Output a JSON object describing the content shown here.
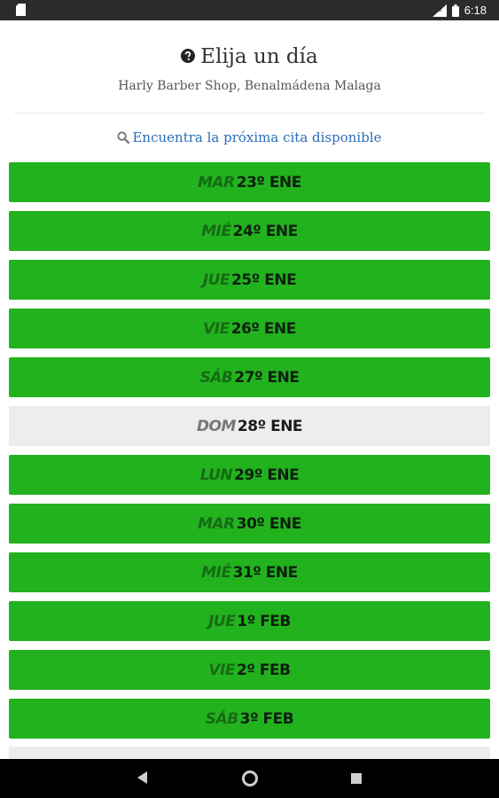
{
  "status_bar": {
    "time": "6:18",
    "icons": [
      "sd-card-icon",
      "signal-icon",
      "battery-icon"
    ]
  },
  "header": {
    "title": "Elija un día",
    "title_icon": "help-circle-icon",
    "subtitle": "Harly Barber Shop, Benalmádena Malaga"
  },
  "find_next": {
    "label": "Encuentra la próxima cita disponible",
    "icon": "search-icon"
  },
  "days": [
    {
      "dow": "MAR",
      "date": "23º ENE",
      "available": true
    },
    {
      "dow": "MIÉ",
      "date": "24º ENE",
      "available": true
    },
    {
      "dow": "JUE",
      "date": "25º ENE",
      "available": true
    },
    {
      "dow": "VIE",
      "date": "26º ENE",
      "available": true
    },
    {
      "dow": "SÁB",
      "date": "27º ENE",
      "available": true
    },
    {
      "dow": "DOM",
      "date": "28º ENE",
      "available": false
    },
    {
      "dow": "LUN",
      "date": "29º ENE",
      "available": true
    },
    {
      "dow": "MAR",
      "date": "30º ENE",
      "available": true
    },
    {
      "dow": "MIÉ",
      "date": "31º ENE",
      "available": true
    },
    {
      "dow": "JUE",
      "date": "1º FEB",
      "available": true
    },
    {
      "dow": "VIE",
      "date": "2º FEB",
      "available": true
    },
    {
      "dow": "SÁB",
      "date": "3º FEB",
      "available": true
    }
  ],
  "colors": {
    "available": "#22b21e",
    "unavailable": "#ededed",
    "link": "#2a6ebb"
  },
  "nav_bar": {
    "buttons": [
      "back-icon",
      "home-icon",
      "recents-icon"
    ]
  }
}
